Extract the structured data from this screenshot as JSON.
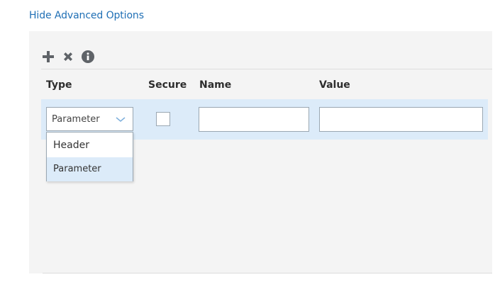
{
  "advanced_link": "Hide Advanced Options",
  "toolbar": {
    "icons": [
      "plus-icon",
      "close-icon",
      "info-icon"
    ],
    "icon_color": "#5f6368"
  },
  "columns": {
    "type": "Type",
    "secure": "Secure",
    "name": "Name",
    "value": "Value"
  },
  "row": {
    "type_value": "Parameter",
    "secure_checked": false,
    "name_value": "",
    "value_value": ""
  },
  "dropdown": {
    "options": [
      "Header",
      "Parameter"
    ],
    "selected": "Parameter"
  },
  "colors": {
    "link": "#1f6fb5",
    "row_highlight": "#dcebf9",
    "panel_bg": "#f4f4f4"
  }
}
